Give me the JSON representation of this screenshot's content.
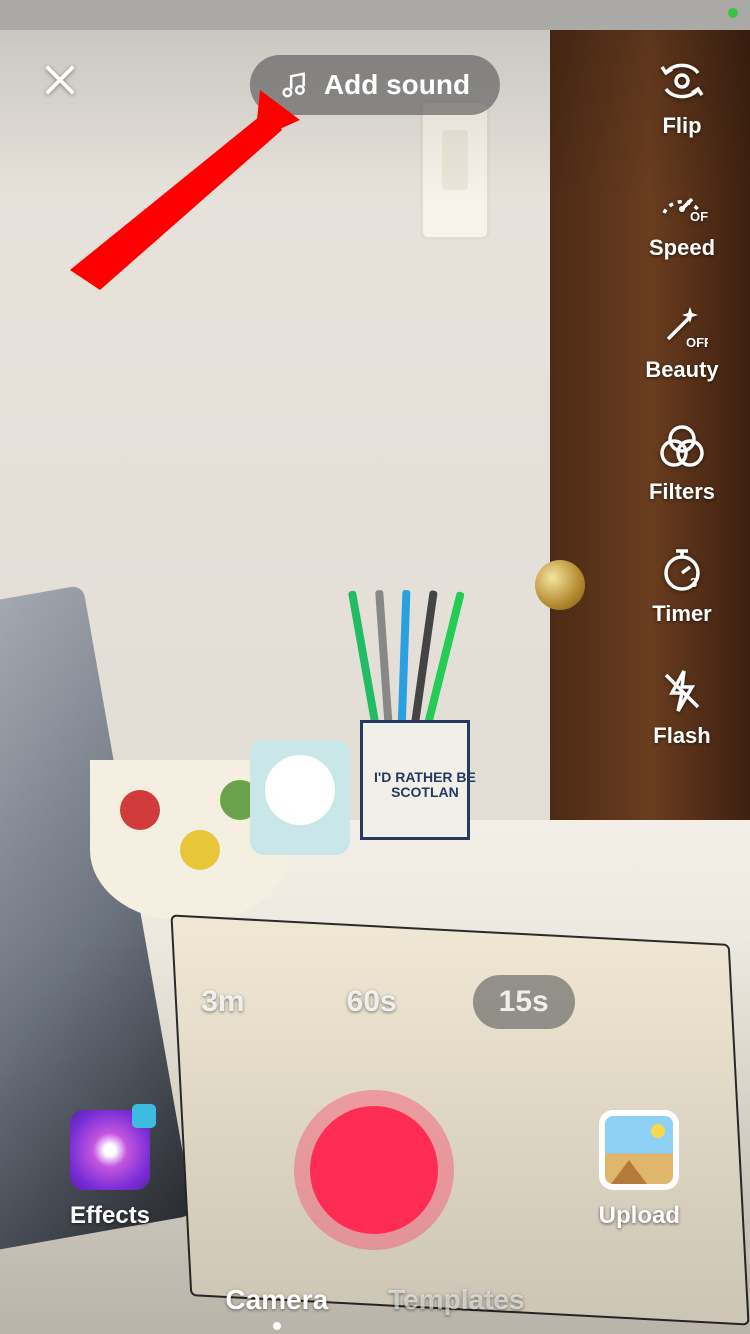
{
  "header": {
    "add_sound_label": "Add sound"
  },
  "tools": {
    "flip": "Flip",
    "speed": "Speed",
    "speed_state": "OFF",
    "beauty": "Beauty",
    "beauty_state": "OFF",
    "filters": "Filters",
    "timer": "Timer",
    "timer_value": "3",
    "flash": "Flash"
  },
  "durations": {
    "options": [
      "3m",
      "60s",
      "15s"
    ],
    "active_index": 2
  },
  "bottom": {
    "effects_label": "Effects",
    "upload_label": "Upload"
  },
  "modes": {
    "options": [
      "Camera",
      "Templates"
    ],
    "active_index": 0
  },
  "scene": {
    "mug_text_line1": "I'D RATHER BE",
    "mug_text_line2": "SCOTLAN"
  }
}
